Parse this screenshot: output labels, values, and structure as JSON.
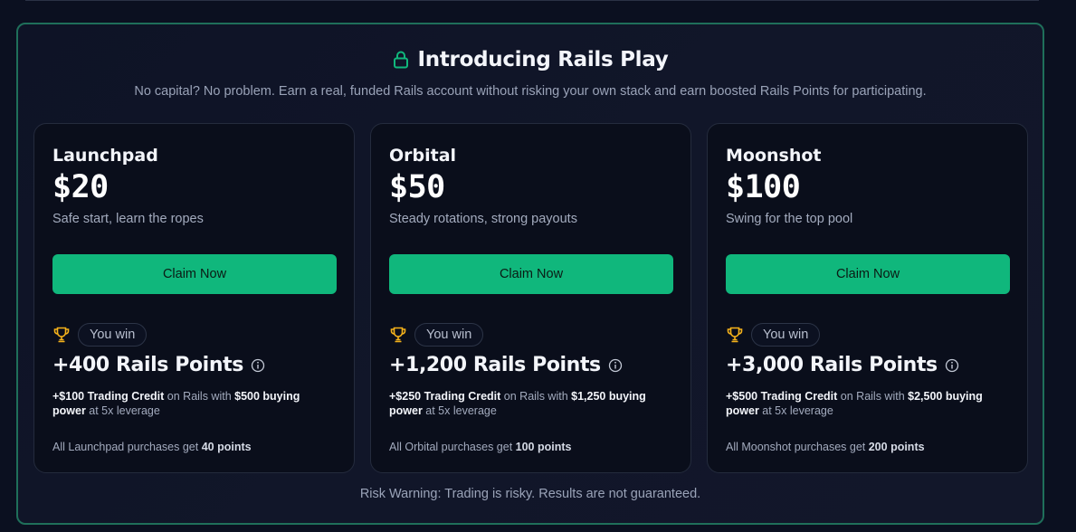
{
  "header": {
    "title": "Introducing Rails Play",
    "subtitle": "No capital? No problem. Earn a real, funded Rails account without risking your own stack and earn boosted Rails Points for participating.",
    "icon": "lock-icon"
  },
  "colors": {
    "accent": "#10b77c",
    "panel_border": "#1f6f5a",
    "trophy": "#f5b21b"
  },
  "plans": [
    {
      "name": "Launchpad",
      "price": "$20",
      "tagline": "Safe start, learn the ropes",
      "cta": "Claim Now",
      "win_label": "You win",
      "points": "+400 Rails Points",
      "credit_amount": "+$100 Trading Credit",
      "credit_mid": " on Rails with ",
      "buying_power": "$500 buying power",
      "credit_tail": " at 5x leverage",
      "footnote_prefix": "All Launchpad purchases get ",
      "footnote_points": "40 points"
    },
    {
      "name": "Orbital",
      "price": "$50",
      "tagline": "Steady rotations, strong payouts",
      "cta": "Claim Now",
      "win_label": "You win",
      "points": "+1,200 Rails Points",
      "credit_amount": "+$250 Trading Credit",
      "credit_mid": " on Rails with ",
      "buying_power": "$1,250 buying power",
      "credit_tail": " at 5x leverage",
      "footnote_prefix": "All Orbital purchases get ",
      "footnote_points": "100 points"
    },
    {
      "name": "Moonshot",
      "price": "$100",
      "tagline": "Swing for the top pool",
      "cta": "Claim Now",
      "win_label": "You win",
      "points": "+3,000 Rails Points",
      "credit_amount": "+$500 Trading Credit",
      "credit_mid": " on Rails with ",
      "buying_power": "$2,500 buying power",
      "credit_tail": " at 5x leverage",
      "footnote_prefix": "All Moonshot purchases get ",
      "footnote_points": "200 points"
    }
  ],
  "risk_warning": "Risk Warning: Trading is risky. Results are not guaranteed."
}
